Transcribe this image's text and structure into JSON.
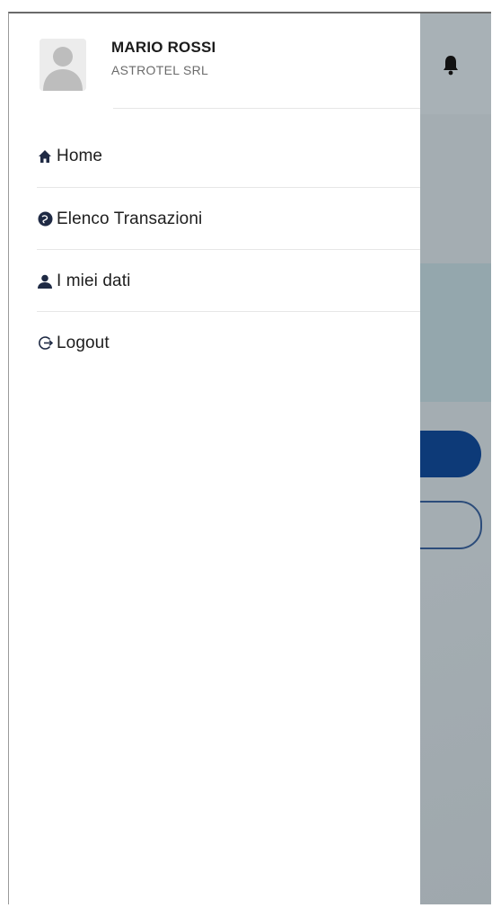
{
  "user": {
    "name": "MARIO ROSSI",
    "company": "ASTROTEL SRL"
  },
  "menu": {
    "items": [
      {
        "label": "Home",
        "icon": "home-icon"
      },
      {
        "label": "Elenco Transazioni",
        "icon": "transactions-icon"
      },
      {
        "label": "I miei dati",
        "icon": "user-icon"
      },
      {
        "label": "Logout",
        "icon": "logout-icon"
      }
    ]
  },
  "colors": {
    "primary": "#0d3a78",
    "overlay": "#a4adb2",
    "icon": "#1f2a44"
  }
}
